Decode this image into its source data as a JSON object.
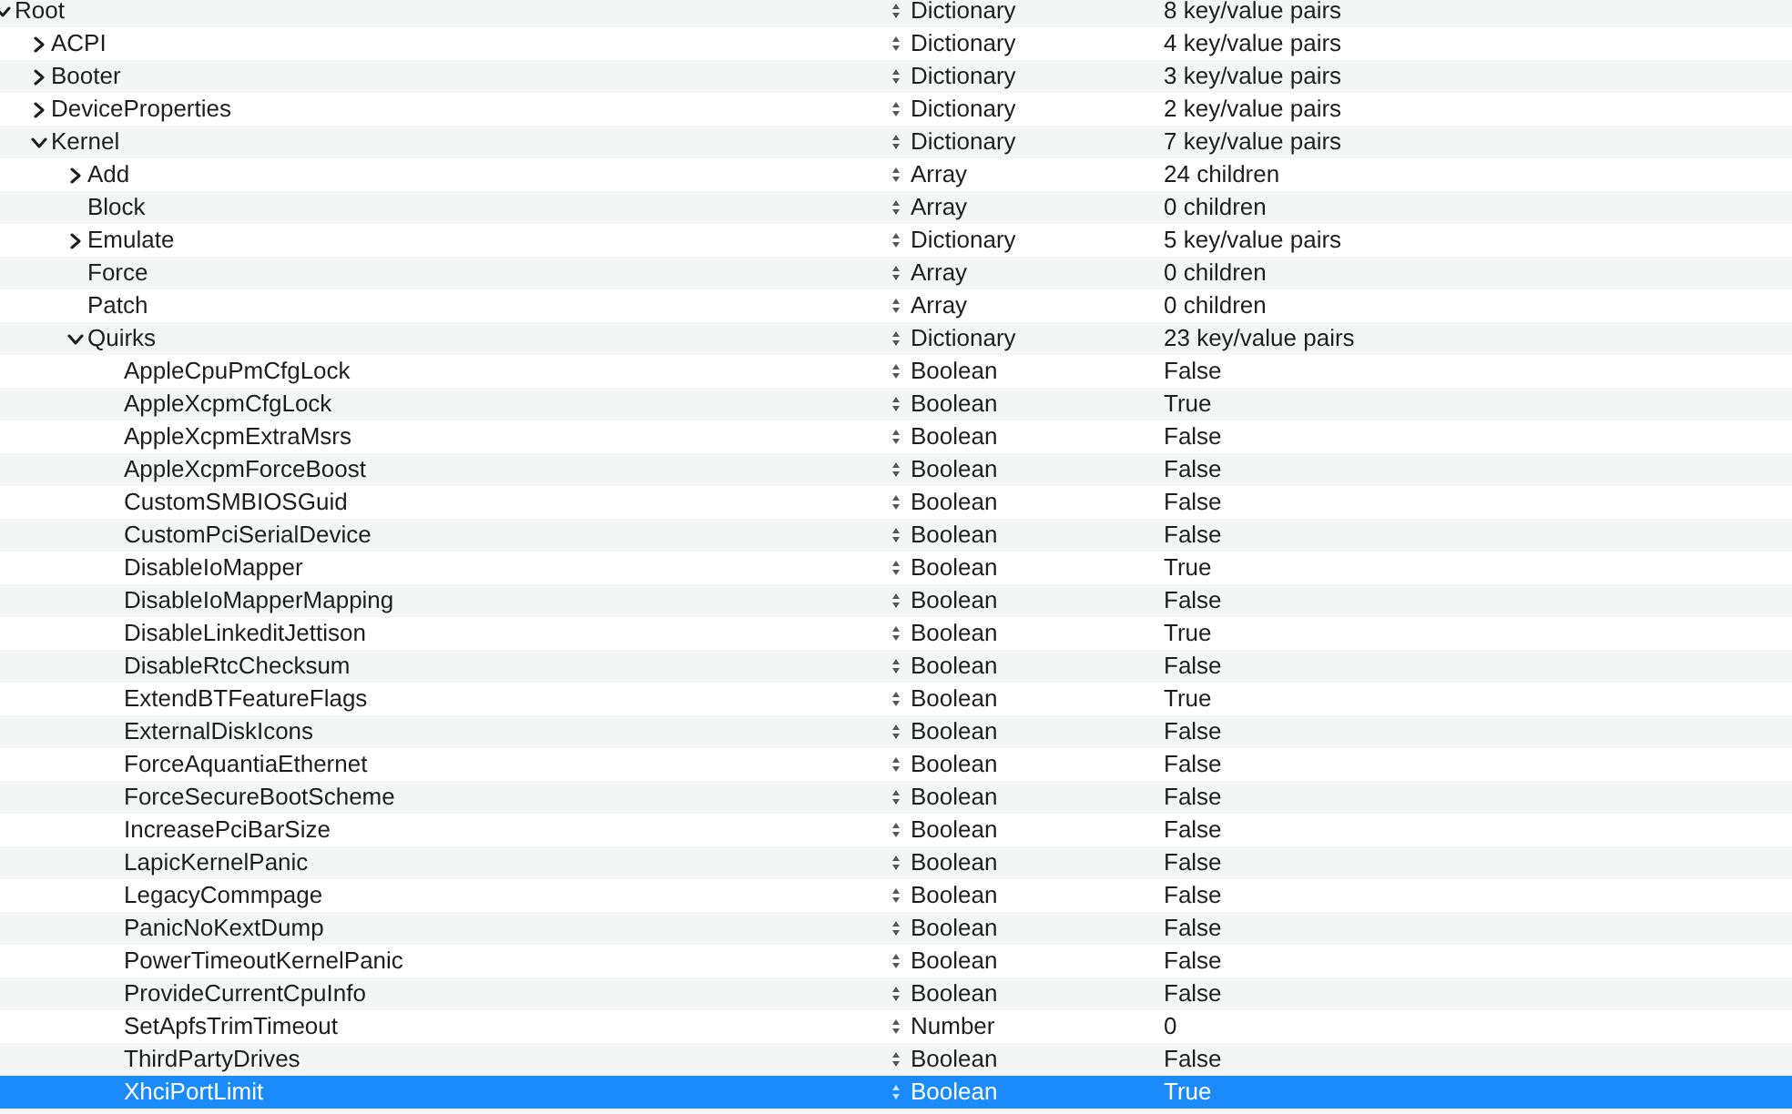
{
  "tree": [
    {
      "key": "Root",
      "type": "Dictionary",
      "value": "8 key/value pairs",
      "expanded": true,
      "selected": false,
      "children": [
        {
          "key": "ACPI",
          "type": "Dictionary",
          "value": "4 key/value pairs",
          "expanded": false,
          "selected": false
        },
        {
          "key": "Booter",
          "type": "Dictionary",
          "value": "3 key/value pairs",
          "expanded": false,
          "selected": false
        },
        {
          "key": "DeviceProperties",
          "type": "Dictionary",
          "value": "2 key/value pairs",
          "expanded": false,
          "selected": false
        },
        {
          "key": "Kernel",
          "type": "Dictionary",
          "value": "7 key/value pairs",
          "expanded": true,
          "selected": false,
          "children": [
            {
              "key": "Add",
              "type": "Array",
              "value": "24 children",
              "expanded": false,
              "selected": false
            },
            {
              "key": "Block",
              "type": "Array",
              "value": "0 children",
              "selected": false
            },
            {
              "key": "Emulate",
              "type": "Dictionary",
              "value": "5 key/value pairs",
              "expanded": false,
              "selected": false
            },
            {
              "key": "Force",
              "type": "Array",
              "value": "0 children",
              "selected": false
            },
            {
              "key": "Patch",
              "type": "Array",
              "value": "0 children",
              "selected": false
            },
            {
              "key": "Quirks",
              "type": "Dictionary",
              "value": "23 key/value pairs",
              "expanded": true,
              "selected": false,
              "children": [
                {
                  "key": "AppleCpuPmCfgLock",
                  "type": "Boolean",
                  "value": "False",
                  "selected": false
                },
                {
                  "key": "AppleXcpmCfgLock",
                  "type": "Boolean",
                  "value": "True",
                  "selected": false
                },
                {
                  "key": "AppleXcpmExtraMsrs",
                  "type": "Boolean",
                  "value": "False",
                  "selected": false
                },
                {
                  "key": "AppleXcpmForceBoost",
                  "type": "Boolean",
                  "value": "False",
                  "selected": false
                },
                {
                  "key": "CustomSMBIOSGuid",
                  "type": "Boolean",
                  "value": "False",
                  "selected": false
                },
                {
                  "key": "CustomPciSerialDevice",
                  "type": "Boolean",
                  "value": "False",
                  "selected": false
                },
                {
                  "key": "DisableIoMapper",
                  "type": "Boolean",
                  "value": "True",
                  "selected": false
                },
                {
                  "key": "DisableIoMapperMapping",
                  "type": "Boolean",
                  "value": "False",
                  "selected": false
                },
                {
                  "key": "DisableLinkeditJettison",
                  "type": "Boolean",
                  "value": "True",
                  "selected": false
                },
                {
                  "key": "DisableRtcChecksum",
                  "type": "Boolean",
                  "value": "False",
                  "selected": false
                },
                {
                  "key": "ExtendBTFeatureFlags",
                  "type": "Boolean",
                  "value": "True",
                  "selected": false
                },
                {
                  "key": "ExternalDiskIcons",
                  "type": "Boolean",
                  "value": "False",
                  "selected": false
                },
                {
                  "key": "ForceAquantiaEthernet",
                  "type": "Boolean",
                  "value": "False",
                  "selected": false
                },
                {
                  "key": "ForceSecureBootScheme",
                  "type": "Boolean",
                  "value": "False",
                  "selected": false
                },
                {
                  "key": "IncreasePciBarSize",
                  "type": "Boolean",
                  "value": "False",
                  "selected": false
                },
                {
                  "key": "LapicKernelPanic",
                  "type": "Boolean",
                  "value": "False",
                  "selected": false
                },
                {
                  "key": "LegacyCommpage",
                  "type": "Boolean",
                  "value": "False",
                  "selected": false
                },
                {
                  "key": "PanicNoKextDump",
                  "type": "Boolean",
                  "value": "False",
                  "selected": false
                },
                {
                  "key": "PowerTimeoutKernelPanic",
                  "type": "Boolean",
                  "value": "False",
                  "selected": false
                },
                {
                  "key": "ProvideCurrentCpuInfo",
                  "type": "Boolean",
                  "value": "False",
                  "selected": false
                },
                {
                  "key": "SetApfsTrimTimeout",
                  "type": "Number",
                  "value": "0",
                  "selected": false
                },
                {
                  "key": "ThirdPartyDrives",
                  "type": "Boolean",
                  "value": "False",
                  "selected": false
                },
                {
                  "key": "XhciPortLimit",
                  "type": "Boolean",
                  "value": "True",
                  "selected": true
                }
              ]
            }
          ]
        }
      ]
    }
  ]
}
